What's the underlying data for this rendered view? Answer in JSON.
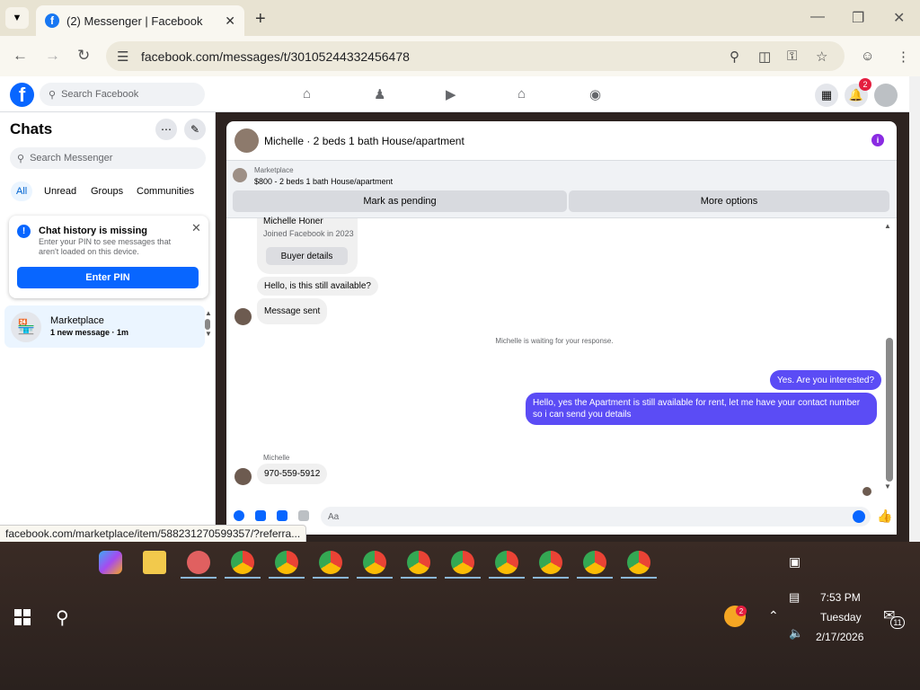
{
  "browser": {
    "tab_title": "(2) Messenger | Facebook",
    "url": "facebook.com/messages/t/30105244332456478",
    "status_url": "facebook.com/marketplace/item/588231270599357/?referra..."
  },
  "facebook": {
    "search_placeholder": "Search Facebook",
    "notification_badge": "2"
  },
  "left": {
    "title": "Chats",
    "search_placeholder": "Search Messenger",
    "filters": [
      "All",
      "Unread",
      "Groups",
      "Communities"
    ],
    "history_card": {
      "title": "Chat history is missing",
      "desc": "Enter your PIN to see messages that aren't loaded on this device.",
      "button": "Enter PIN"
    },
    "chat_item": {
      "name": "Marketplace",
      "sub": "1 new message · 1m"
    }
  },
  "conversation": {
    "title": "Michelle · 2 beds 1 bath House/apartment",
    "marketplace_label": "Marketplace",
    "listing": "$800 - 2 beds 1 bath House/apartment",
    "mark_pending": "Mark as pending",
    "more_options": "More options",
    "buyer": {
      "name": "Michelle Honer",
      "joined": "Joined Facebook in 2023",
      "button": "Buyer details"
    },
    "messages": {
      "in1": "Hello, is this still available?",
      "in2": "Message sent",
      "waiting": "Michelle is waiting for your response.",
      "out1": "Yes. Are you interested?",
      "out2": "Hello, yes the Apartment is still available for rent, let me have your contact number so i can send you details",
      "sender": "Michelle",
      "in3": "970-559-5912"
    },
    "composer_placeholder": "Aa"
  },
  "taskbar": {
    "time": "7:53 PM",
    "day": "Tuesday",
    "date": "2/17/2026",
    "notification_count": "11",
    "weather_badge": "2"
  },
  "colors": {
    "brand": "#0866ff",
    "outgoing_bubble": "#5b4cf5"
  }
}
